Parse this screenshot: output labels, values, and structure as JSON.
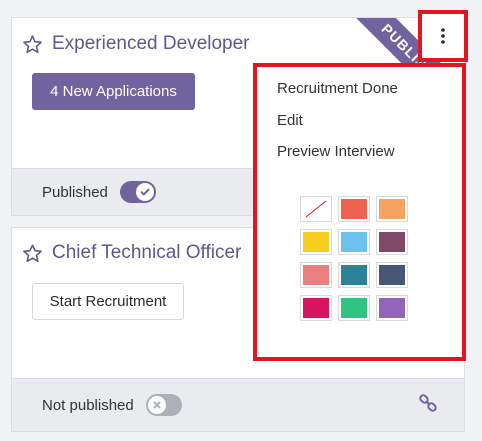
{
  "cards": [
    {
      "title": "Experienced Developer",
      "action_label": "4 New Applications",
      "status_label": "Published",
      "published": true,
      "ribbon": "PUBLISHED"
    },
    {
      "title": "Chief Technical Officer",
      "action_label": "Start Recruitment",
      "status_label": "Not published",
      "published": false
    }
  ],
  "dropdown": {
    "items": [
      "Recruitment Done",
      "Edit",
      "Preview Interview"
    ],
    "colors": [
      {
        "name": "no-color",
        "hex": "#ffffff"
      },
      {
        "name": "red",
        "hex": "#f06050"
      },
      {
        "name": "orange",
        "hex": "#f4a460"
      },
      {
        "name": "yellow",
        "hex": "#f7cd1f"
      },
      {
        "name": "light-blue",
        "hex": "#6cc1ed"
      },
      {
        "name": "dark-purple",
        "hex": "#814968"
      },
      {
        "name": "salmon-pink",
        "hex": "#eb7e7f"
      },
      {
        "name": "medium-blue",
        "hex": "#2c8397"
      },
      {
        "name": "dark-blue",
        "hex": "#475577"
      },
      {
        "name": "fuchsia",
        "hex": "#d6145f"
      },
      {
        "name": "green",
        "hex": "#30c381"
      },
      {
        "name": "purple",
        "hex": "#9365b8"
      }
    ]
  },
  "accent_color": "#71639e",
  "highlight_color": "#e3151f"
}
